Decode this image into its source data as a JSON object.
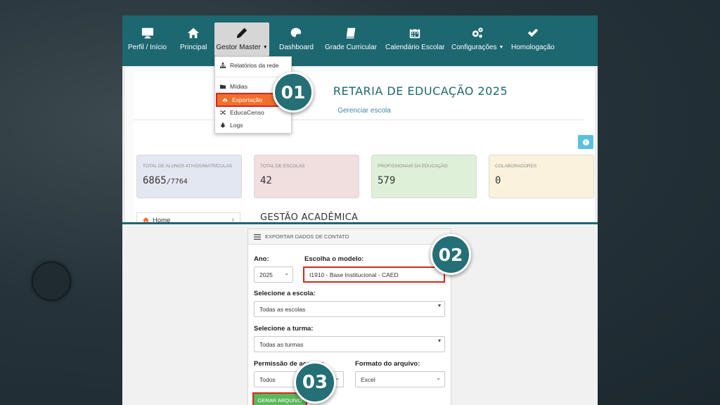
{
  "nav": {
    "items": [
      {
        "label": "Perfil / Início",
        "icon": "monitor-icon"
      },
      {
        "label": "Principal",
        "icon": "home-icon"
      },
      {
        "label": "Gestor Master",
        "icon": "pencil-icon",
        "active": true
      },
      {
        "label": "Dashboard",
        "icon": "palette-icon"
      },
      {
        "label": "Grade Curricular",
        "icon": "book-icon"
      },
      {
        "label": "Calendário Escolar",
        "icon": "calendar-icon"
      },
      {
        "label": "Configurações",
        "icon": "gears-icon"
      },
      {
        "label": "Homologação",
        "icon": "check-icon"
      }
    ]
  },
  "dropdown": {
    "items": [
      {
        "label": "Relatórios da rede",
        "icon": "sitemap-icon"
      },
      {
        "label": "Mídias",
        "icon": "folder-icon"
      },
      {
        "label": "Exportação",
        "icon": "cloud-download-icon",
        "active": true
      },
      {
        "label": "EducaCenso",
        "icon": "shuffle-icon"
      },
      {
        "label": "Logs",
        "icon": "bug-icon"
      }
    ]
  },
  "header": {
    "title": "RETARIA DE EDUCAÇÃO 2025",
    "manage_link": "Gerenciar escola"
  },
  "stats": [
    {
      "label": "TOTAL DE ALUNOS ATIVOS/MATRÍCULAS",
      "value": "6865",
      "sub": "/7764",
      "color": "#e3e7f1"
    },
    {
      "label": "TOTAL DE ESCOLAS",
      "value": "42",
      "sub": "",
      "color": "#f1dede"
    },
    {
      "label": "PROFISSIONAIS DA EDUCAÇÃO",
      "value": "579",
      "sub": "",
      "color": "#dff0d8"
    },
    {
      "label": "COLABORADORES",
      "value": "0",
      "sub": "",
      "color": "#faf2dc"
    }
  ],
  "sidebar": {
    "home_label": "Home",
    "chevron": "›"
  },
  "section_title": "GESTÃO ACADÊMICA",
  "export": {
    "header": "EXPORTAR DADOS DE CONTATO",
    "year_label": "Ano:",
    "year_value": "2025",
    "model_label": "Escolha o modelo:",
    "model_value": "I1910 - Base Institucional - CAED",
    "school_label": "Selecione a escola:",
    "school_value": "Todas as escolas",
    "class_label": "Selecione a turma:",
    "class_value": "Todas as turmas",
    "permission_label": "Permissão de acesso:",
    "permission_value": "Todos",
    "format_label": "Formato do arquivo:",
    "format_value": "Excel",
    "generate_button": "GERAR ARQUIVO"
  },
  "callouts": [
    "01",
    "02",
    "03"
  ],
  "colors": {
    "brand": "#1d6770",
    "highlight": "#d4271d",
    "active_menu": "#f0702c",
    "button_green": "#5cb85c",
    "info": "#5bc0de"
  }
}
